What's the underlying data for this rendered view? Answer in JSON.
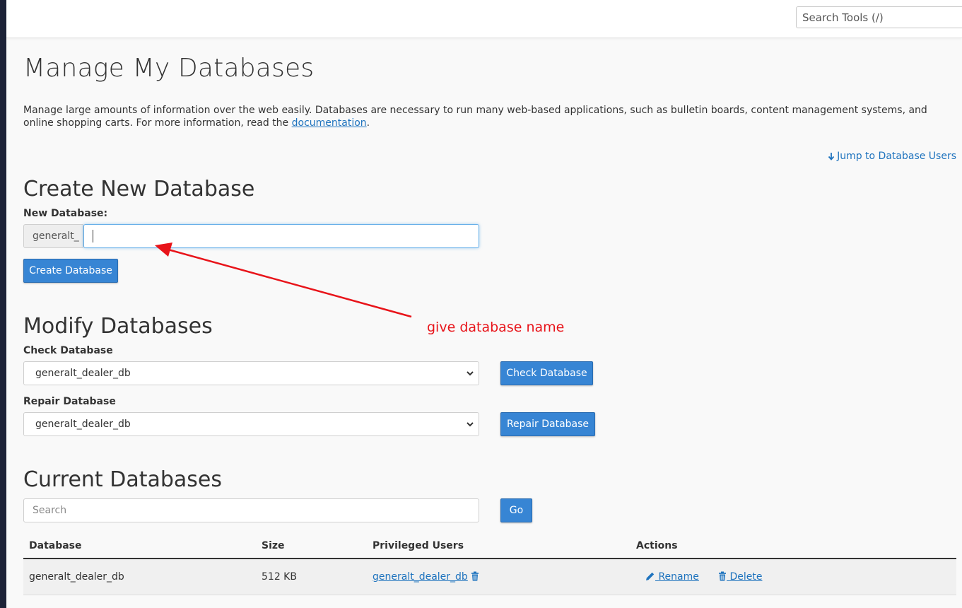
{
  "header": {
    "search_placeholder": "Search Tools (/)"
  },
  "page": {
    "title": "Manage My Databases",
    "intro_text": "Manage large amounts of information over the web easily. Databases are necessary to run many web-based applications, such as bulletin boards, content management systems, and online shopping carts. For more information, read the ",
    "intro_link": "documentation",
    "intro_end": ".",
    "jump_link": "Jump to Database Users"
  },
  "create": {
    "heading": "Create New Database",
    "label": "New Database:",
    "prefix": "generalt_",
    "input_value": "",
    "button": "Create Database"
  },
  "modify": {
    "heading": "Modify Databases",
    "check_label": "Check Database",
    "check_selected": "generalt_dealer_db",
    "check_button": "Check Database",
    "repair_label": "Repair Database",
    "repair_selected": "generalt_dealer_db",
    "repair_button": "Repair Database"
  },
  "current": {
    "heading": "Current Databases",
    "search_placeholder": "Search",
    "go_button": "Go",
    "columns": [
      "Database",
      "Size",
      "Privileged Users",
      "Actions"
    ],
    "rows": [
      {
        "database": "generalt_dealer_db",
        "size": "512 KB",
        "user": "generalt_dealer_db",
        "rename": "Rename",
        "delete": "Delete"
      }
    ]
  },
  "annotation": {
    "text": "give database name",
    "color": "#e8141a"
  },
  "colors": {
    "primary_button": "#3785d4",
    "link": "#1e73be",
    "sidebar": "#1c2237"
  }
}
